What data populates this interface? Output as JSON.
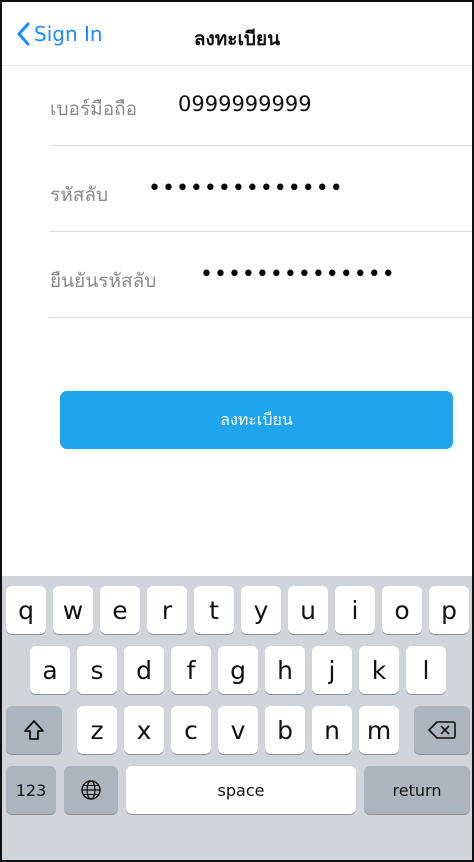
{
  "nav": {
    "back_label": "Sign In",
    "title": "ลงทะเบียน"
  },
  "form": {
    "phone": {
      "label": "เบอร์มือถือ",
      "value": "0999999999"
    },
    "password": {
      "label": "รหัสลับ",
      "value": "••••••••••••••"
    },
    "confirm": {
      "label": "ยืนยันรหัสลับ",
      "value": "••••••••••••••"
    }
  },
  "register_button": "ลงทะเบียน",
  "keyboard": {
    "row1": [
      "q",
      "w",
      "e",
      "r",
      "t",
      "y",
      "u",
      "i",
      "o",
      "p"
    ],
    "row2": [
      "a",
      "s",
      "d",
      "f",
      "g",
      "h",
      "j",
      "k",
      "l"
    ],
    "row3": [
      "z",
      "x",
      "c",
      "v",
      "b",
      "n",
      "m"
    ],
    "numbers_label": "123",
    "space_label": "space",
    "return_label": "return"
  },
  "colors": {
    "accent": "#1a8cff",
    "button": "#1fa5ee",
    "keyboard_bg": "#d1d4d9"
  }
}
